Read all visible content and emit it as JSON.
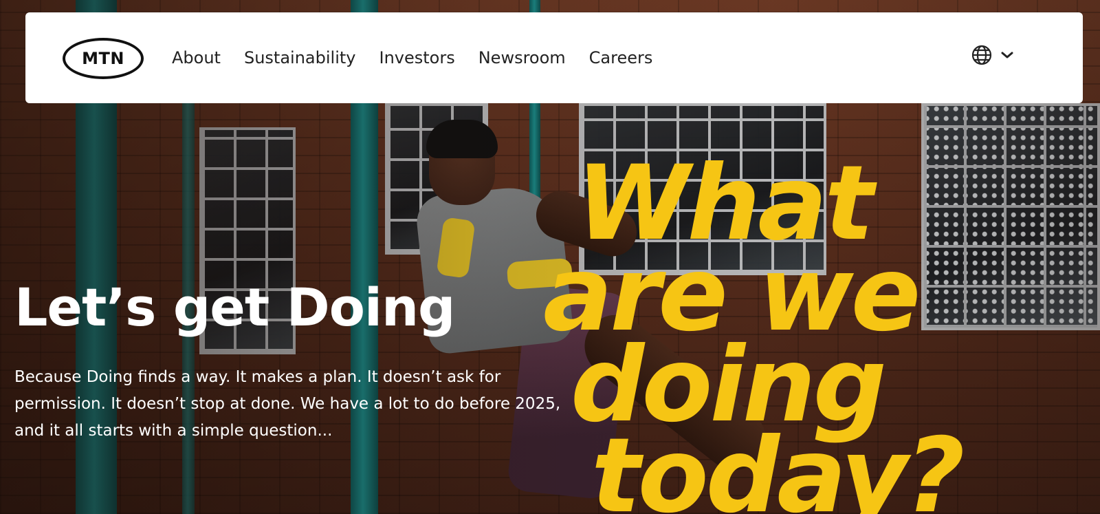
{
  "brand": {
    "logo_text": "MTN"
  },
  "nav": {
    "links": [
      "About",
      "Sustainability",
      "Investors",
      "Newsroom",
      "Careers"
    ],
    "language_icon": "globe-icon",
    "language_chevron": "chevron-down-icon"
  },
  "hero": {
    "title": "Let’s get Doing",
    "body": "Because Doing finds a way. It makes a plan. It doesn’t ask for permission. It doesn’t stop at done. We have a lot to do before 2025, and it all starts with a simple question...",
    "slogan_lines": [
      "What",
      "are we",
      "doing",
      "today?"
    ]
  },
  "colors": {
    "slogan_yellow": "#f6c514",
    "nav_background": "#ffffff",
    "text_dark": "#222222",
    "pipe_teal": "#1b8f8d"
  }
}
